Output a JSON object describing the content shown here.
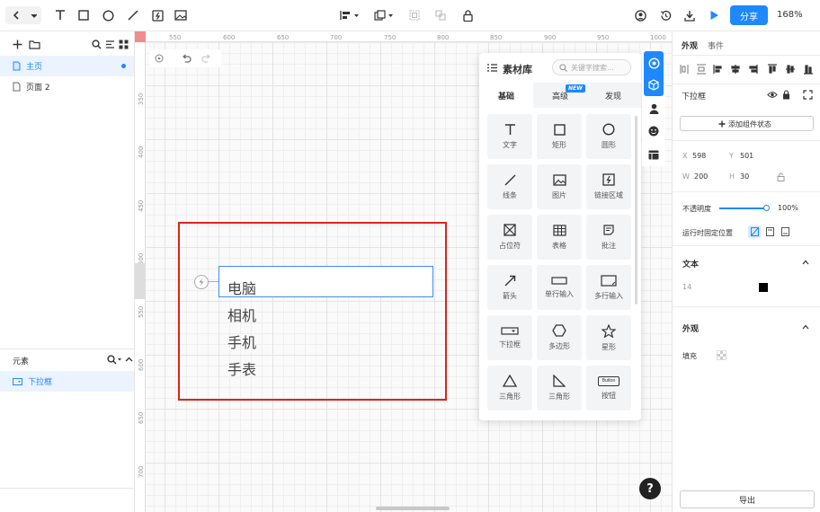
{
  "toolbar": {
    "share_label": "分享",
    "zoom": "168%"
  },
  "pages": {
    "items": [
      {
        "label": "主页",
        "selected": true
      },
      {
        "label": "页面 2",
        "selected": false
      }
    ]
  },
  "elements": {
    "header": "元素",
    "items": [
      {
        "label": "下拉框"
      }
    ]
  },
  "ruler": {
    "h": [
      "550",
      "600",
      "650",
      "700",
      "750",
      "800",
      "850",
      "900",
      "950",
      "1000"
    ],
    "v": [
      "350",
      "400",
      "450",
      "500",
      "550",
      "600",
      "650",
      "700"
    ]
  },
  "dropdown": {
    "options": [
      "电脑",
      "相机",
      "手机",
      "手表"
    ]
  },
  "assets": {
    "title": "素材库",
    "search_placeholder": "关键字搜索...",
    "tabs": [
      "基础",
      "高级",
      "发现"
    ],
    "new_badge": "NEW",
    "tiles": [
      "文字",
      "矩形",
      "圆形",
      "线条",
      "图片",
      "链接区域",
      "占位符",
      "表格",
      "批注",
      "箭头",
      "单行输入",
      "多行输入",
      "下拉框",
      "多边形",
      "星形",
      "三角形",
      "三角形",
      "按钮"
    ],
    "button_icon_text": "Button"
  },
  "properties": {
    "tabs": [
      "外观",
      "事件"
    ],
    "component_name": "下拉框",
    "add_state_label": "添加组件状态",
    "x_label": "X",
    "x": "598",
    "y_label": "Y",
    "y": "501",
    "w_label": "W",
    "w": "200",
    "h_label": "H",
    "h": "30",
    "opacity_label": "不透明度",
    "opacity": "100%",
    "opacity_value": 1.0,
    "fixed_label": "运行时固定位置",
    "text_section": "文本",
    "font_size": "14",
    "text_color": "#000000",
    "appearance_section": "外观",
    "fill_label": "填充",
    "export_label": "导出"
  },
  "help_label": "?",
  "collapse_label": "«",
  "colors": {
    "accent": "#1e88ff",
    "selection": "#d8261c"
  }
}
